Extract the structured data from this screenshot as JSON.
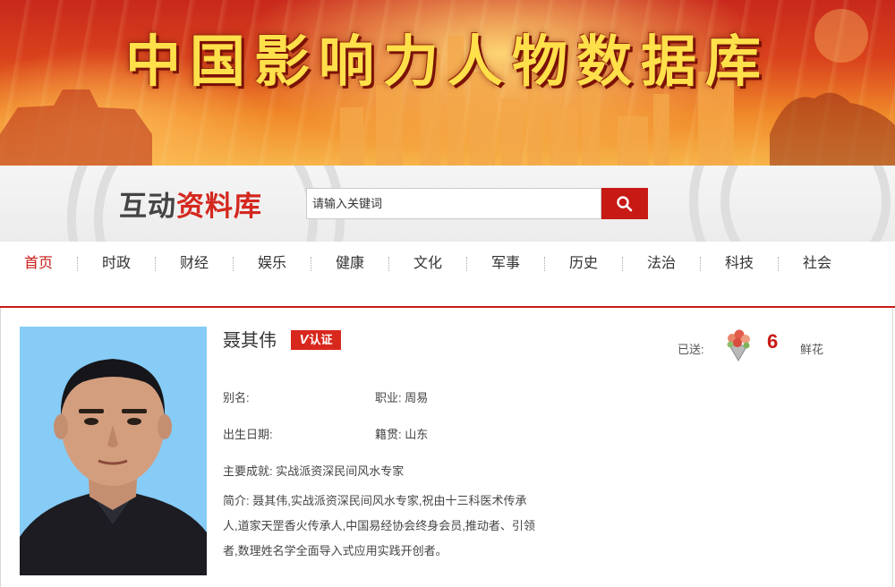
{
  "banner": {
    "title": "中国影响力人物数据库"
  },
  "search": {
    "logo_part1": "互动",
    "logo_part2": "资料库",
    "placeholder": "请输入关键词",
    "button_icon": "search-icon"
  },
  "nav": {
    "items": [
      "首页",
      "时政",
      "财经",
      "娱乐",
      "健康",
      "文化",
      "军事",
      "历史",
      "法治",
      "科技",
      "社会"
    ],
    "active": "首页"
  },
  "profile": {
    "name": "聂其伟",
    "badge_v": "V",
    "badge_text": "认证",
    "sent_label": "已送:",
    "flower_icon": "bouquet-icon",
    "flower_count": "6",
    "flower_unit": "鲜花",
    "alias_label": "别名:",
    "occupation": "职业: 周易",
    "birth_label": "出生日期:",
    "native_place": "籍贯: 山东",
    "achievement": "主要成就: 实战派资深民间风水专家",
    "bio": "简介: 聂其伟,实战派资深民间风水专家,祝由十三科医术传承人,道家天罡香火传承人,中国易经协会终身会员,推动者、引领者,数理姓名学全面导入式应用实践开创者。"
  },
  "colors": {
    "accent": "#c81a14",
    "banner_gold": "#ffe04a"
  }
}
